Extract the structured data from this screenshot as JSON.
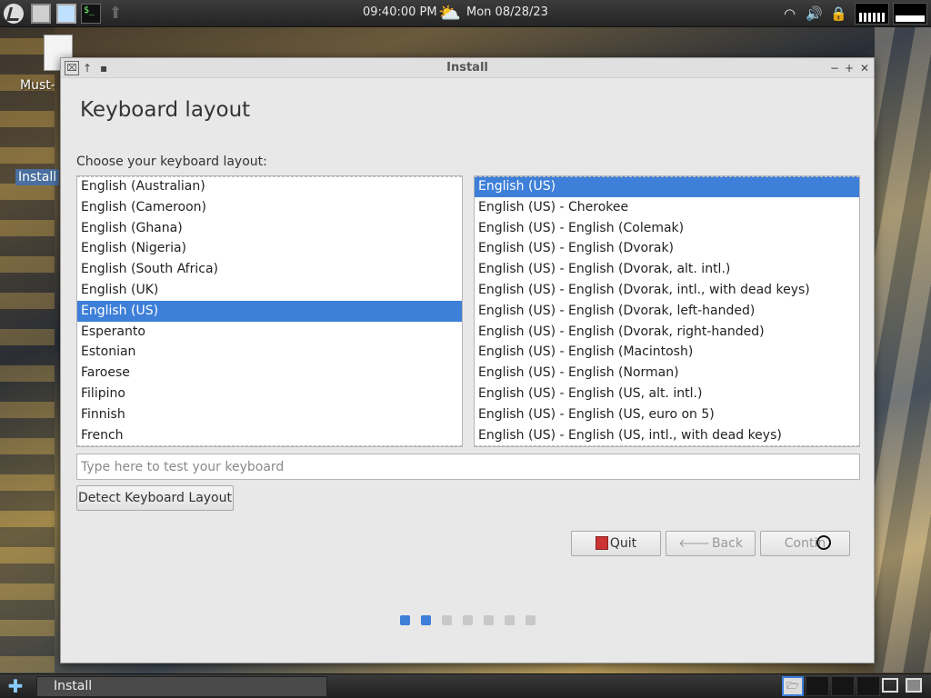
{
  "top_panel": {
    "clock": "09:40:00 PM",
    "date": "Mon 08/28/23",
    "icons": [
      "logo-icon",
      "files-icon",
      "monitor-icon",
      "terminal-icon",
      "up-arrow-icon",
      "weather-icon",
      "wifi-icon",
      "volume-icon",
      "lock-icon"
    ],
    "terminal_glyph": "$_"
  },
  "desktop": {
    "doc_label": "Must-",
    "install_label": "Install"
  },
  "window": {
    "title": "Install",
    "page_title": "Keyboard layout",
    "prompt": "Choose your keyboard layout:",
    "layouts": [
      "English (Australian)",
      "English (Cameroon)",
      "English (Ghana)",
      "English (Nigeria)",
      "English (South Africa)",
      "English (UK)",
      "English (US)",
      "Esperanto",
      "Estonian",
      "Faroese",
      "Filipino",
      "Finnish",
      "French"
    ],
    "selected_layout": "English (US)",
    "variants": [
      "English (US)",
      "English (US) - Cherokee",
      "English (US) - English (Colemak)",
      "English (US) - English (Dvorak)",
      "English (US) - English (Dvorak, alt. intl.)",
      "English (US) - English (Dvorak, intl., with dead keys)",
      "English (US) - English (Dvorak, left-handed)",
      "English (US) - English (Dvorak, right-handed)",
      "English (US) - English (Macintosh)",
      "English (US) - English (Norman)",
      "English (US) - English (US, alt. intl.)",
      "English (US) - English (US, euro on 5)",
      "English (US) - English (US, intl., with dead keys)"
    ],
    "selected_variant": "English (US)",
    "test_placeholder": "Type here to test your keyboard",
    "test_value": "",
    "detect_button": "Detect Keyboard Layout",
    "quit_button": "Quit",
    "back_button": "Back",
    "continue_button": "Contin",
    "progress": {
      "total_steps": 7,
      "current_step": 2
    },
    "accent_color": "#3d7fd9"
  },
  "taskbar": {
    "task_label": "Install",
    "workspace_glyph": "🗁"
  }
}
